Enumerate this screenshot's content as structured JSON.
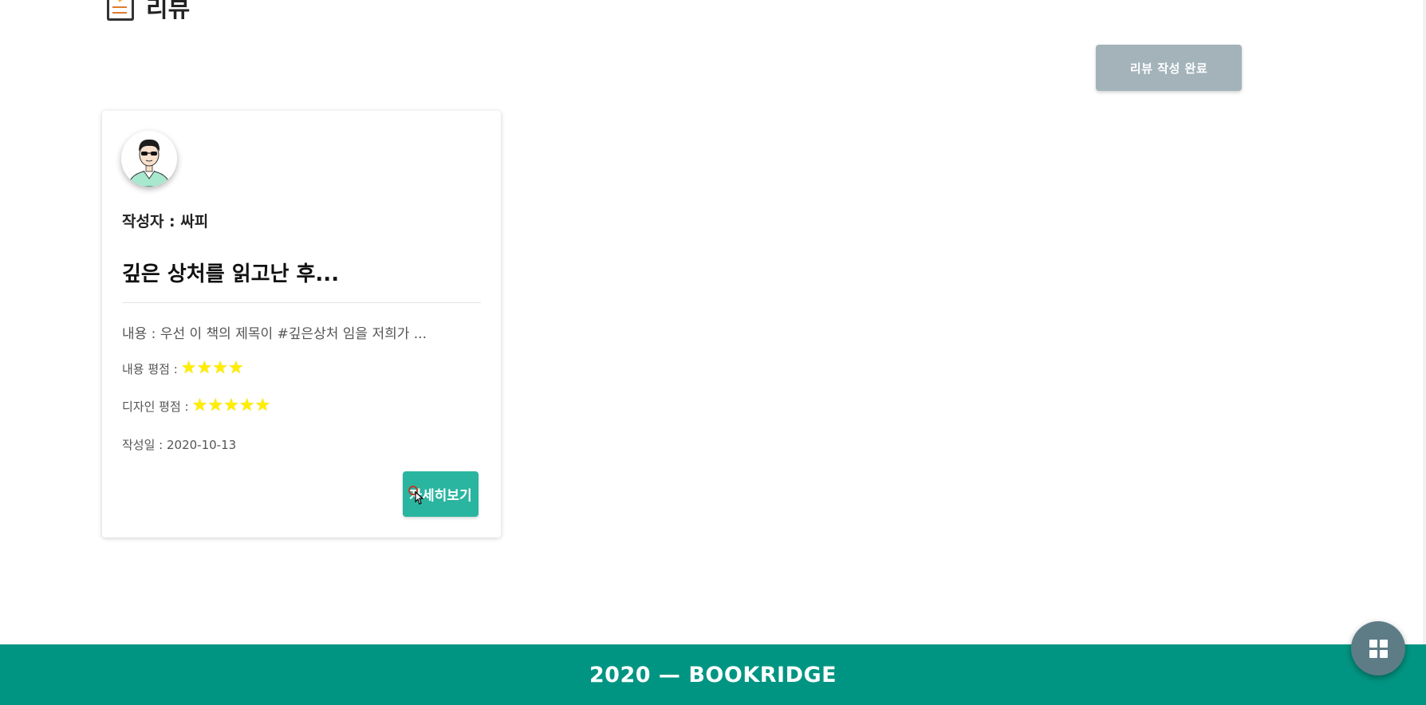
{
  "section": {
    "icon": "memo-icon",
    "title": "리뷰"
  },
  "actions": {
    "done_label": "리뷰 작성 완료"
  },
  "review": {
    "author": "작성자 : 싸피",
    "title": "깊은 상처를 읽고난 후...",
    "content": "내용 : 우선 이 책의 제목이 #깊은상처 임을 저희가 ...",
    "content_rating_label": "내용 평점 :",
    "content_rating": 4,
    "design_rating_label": "디자인 평점 :",
    "design_rating": 5,
    "date": "작성일 : 2020-10-13",
    "detail_label": "자세히보기",
    "avatar_icon": "person-avatar-icon"
  },
  "footer": {
    "text": "2020 — BOOKRIDGE"
  },
  "fab": {
    "icon": "apps-grid-icon"
  },
  "colors": {
    "footer_bg": "#009582",
    "detail_button": "#2ab5a0",
    "done_button": "#a4b3ba",
    "star": "#ffee00",
    "fab": "#5d7c86"
  }
}
